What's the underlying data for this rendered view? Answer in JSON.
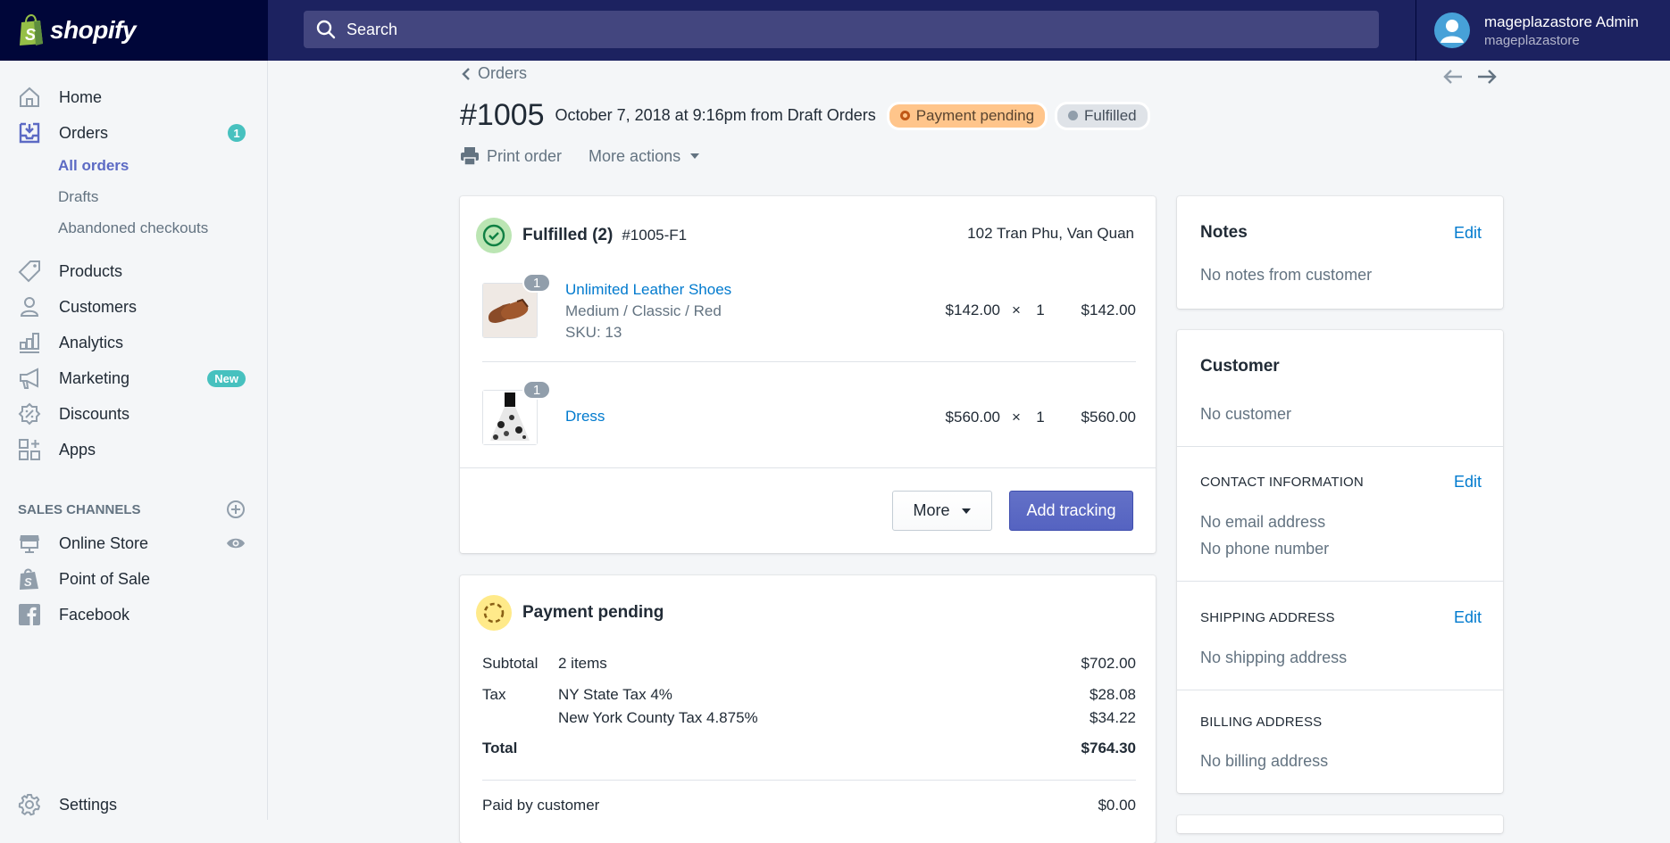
{
  "topbar": {
    "brand": "shopify",
    "search_placeholder": "Search",
    "user_name": "mageplazastore Admin",
    "store_name": "mageplazastore"
  },
  "sidebar": {
    "items": [
      {
        "label": "Home",
        "icon": "home-icon"
      },
      {
        "label": "Orders",
        "icon": "orders-icon",
        "badge": "1"
      },
      {
        "label": "Products",
        "icon": "tag-icon"
      },
      {
        "label": "Customers",
        "icon": "customer-icon"
      },
      {
        "label": "Analytics",
        "icon": "analytics-icon"
      },
      {
        "label": "Marketing",
        "icon": "megaphone-icon",
        "badge": "New"
      },
      {
        "label": "Discounts",
        "icon": "discount-icon"
      },
      {
        "label": "Apps",
        "icon": "apps-icon"
      }
    ],
    "orders_sub": [
      "All orders",
      "Drafts",
      "Abandoned checkouts"
    ],
    "sales_channels_heading": "SALES CHANNELS",
    "channels": [
      {
        "label": "Online Store",
        "icon": "store-icon"
      },
      {
        "label": "Point of Sale",
        "icon": "pos-bag-icon"
      },
      {
        "label": "Facebook",
        "icon": "facebook-icon"
      }
    ],
    "settings_label": "Settings"
  },
  "page": {
    "breadcrumb": "Orders",
    "order_number": "#1005",
    "subtitle": "October 7, 2018 at 9:16pm from Draft Orders",
    "badges": {
      "payment": "Payment pending",
      "fulfillment": "Fulfilled"
    },
    "actions": {
      "print": "Print order",
      "more": "More actions"
    }
  },
  "fulfillment": {
    "title": "Fulfilled (2)",
    "id": "#1005-F1",
    "location": "102 Tran Phu, Van Quan",
    "items": [
      {
        "name": "Unlimited Leather Shoes",
        "variant": "Medium / Classic / Red",
        "sku": "SKU: 13",
        "qty_badge": "1",
        "price": "$142.00",
        "times": "×",
        "quantity": "1",
        "total": "$142.00"
      },
      {
        "name": "Dress",
        "variant": "",
        "sku": "",
        "qty_badge": "1",
        "price": "$560.00",
        "times": "×",
        "quantity": "1",
        "total": "$560.00"
      }
    ],
    "more_button": "More",
    "add_tracking_button": "Add tracking"
  },
  "payment": {
    "title": "Payment pending",
    "subtotal": {
      "label": "Subtotal",
      "desc": "2 items",
      "amount": "$702.00"
    },
    "tax": {
      "label": "Tax",
      "lines": [
        {
          "desc": "NY State Tax 4%",
          "amount": "$28.08"
        },
        {
          "desc": "New York County Tax 4.875%",
          "amount": "$34.22"
        }
      ]
    },
    "total": {
      "label": "Total",
      "amount": "$764.30"
    },
    "paid": {
      "label": "Paid by customer",
      "amount": "$0.00"
    }
  },
  "notes": {
    "title": "Notes",
    "edit": "Edit",
    "text": "No notes from customer"
  },
  "customer": {
    "title": "Customer",
    "text": "No customer",
    "contact": {
      "heading": "CONTACT INFORMATION",
      "edit": "Edit",
      "email": "No email address",
      "phone": "No phone number"
    },
    "shipping": {
      "heading": "SHIPPING ADDRESS",
      "edit": "Edit",
      "text": "No shipping address"
    },
    "billing": {
      "heading": "BILLING ADDRESS",
      "text": "No billing address"
    }
  },
  "colors": {
    "topbar": "#1c2260",
    "logo_bg": "#000639",
    "primary": "#5c6ac4",
    "link": "#007ace",
    "teal_badge": "#47c1bf",
    "pending_badge": "#ffc58b",
    "fulfilled_green": "#bbe5b3"
  }
}
